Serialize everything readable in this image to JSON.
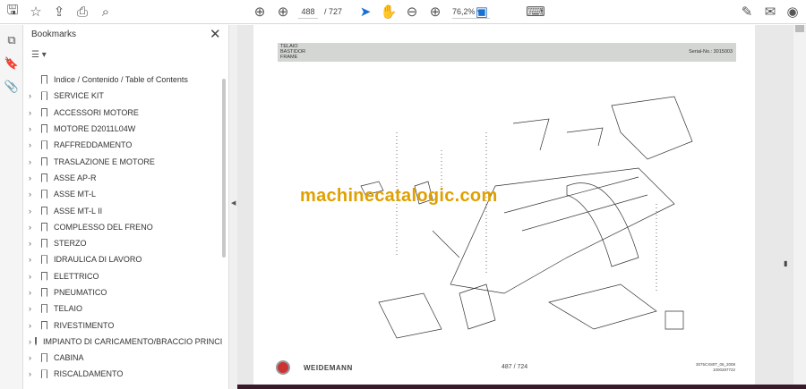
{
  "toolbar": {
    "current_page": "488",
    "total_pages": "/ 727",
    "zoom": "76,2%"
  },
  "bookmarks": {
    "title": "Bookmarks",
    "items": [
      {
        "label": "Indice / Contenido / Table of Contents",
        "expandable": false
      },
      {
        "label": "SERVICE KIT",
        "expandable": true
      },
      {
        "label": "ACCESSORI MOTORE",
        "expandable": true
      },
      {
        "label": "MOTORE D2011L04W",
        "expandable": true
      },
      {
        "label": "RAFFREDDAMENTO",
        "expandable": true
      },
      {
        "label": "TRASLAZIONE E MOTORE",
        "expandable": true
      },
      {
        "label": "ASSE AP-R",
        "expandable": true
      },
      {
        "label": "ASSE MT-L",
        "expandable": true
      },
      {
        "label": "ASSE MT-L II",
        "expandable": true
      },
      {
        "label": "COMPLESSO DEL FRENO",
        "expandable": true
      },
      {
        "label": "STERZO",
        "expandable": true
      },
      {
        "label": "IDRAULICA DI LAVORO",
        "expandable": true
      },
      {
        "label": "ELETTRICO",
        "expandable": true
      },
      {
        "label": "PNEUMATICO",
        "expandable": true
      },
      {
        "label": "TELAIO",
        "expandable": true
      },
      {
        "label": "RIVESTIMENTO",
        "expandable": true
      },
      {
        "label": "IMPIANTO DI CARICAMENTO/BRACCIO PRINCIPA",
        "expandable": true
      },
      {
        "label": "CABINA",
        "expandable": true
      },
      {
        "label": "RISCALDAMENTO",
        "expandable": true
      }
    ]
  },
  "page": {
    "header_lines": [
      "TELAIO",
      "BASTIDOR",
      "FRAME"
    ],
    "serial": "Serial-No.: 3015003",
    "watermark": "machinecatalogic.com",
    "brand": "WEIDEMANN",
    "page_label": "487 / 724",
    "code_lines": [
      "3075CX80T_06_2008",
      "1000287722"
    ]
  }
}
